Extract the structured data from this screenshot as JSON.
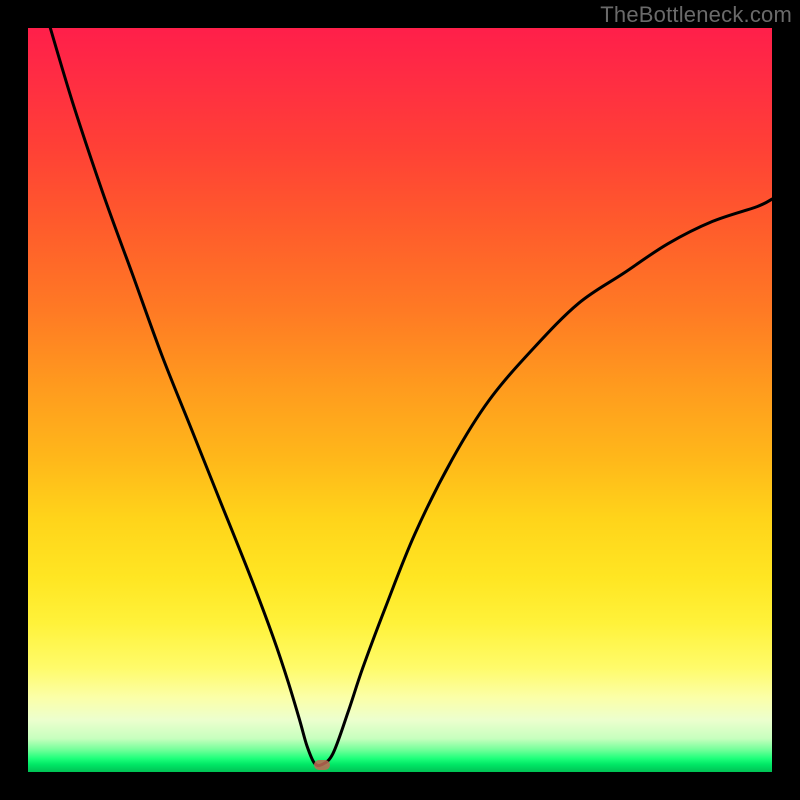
{
  "watermark": "TheBottleneck.com",
  "chart_data": {
    "type": "line",
    "title": "",
    "xlabel": "",
    "ylabel": "",
    "xlim": [
      0,
      100
    ],
    "ylim": [
      0,
      100
    ],
    "series": [
      {
        "name": "curve",
        "x": [
          3,
          6,
          10,
          14,
          18,
          22,
          26,
          30,
          33,
          35,
          36.5,
          37.5,
          38.5,
          39.5,
          41,
          43,
          45,
          48,
          52,
          57,
          62,
          68,
          74,
          80,
          86,
          92,
          98,
          100
        ],
        "values": [
          100,
          90,
          78,
          67,
          56,
          46,
          36,
          26,
          18,
          12,
          7,
          3.5,
          1.2,
          1.0,
          2.5,
          8,
          14,
          22,
          32,
          42,
          50,
          57,
          63,
          67,
          71,
          74,
          76,
          77
        ]
      }
    ],
    "notch": {
      "x": 39.5,
      "y": 1
    },
    "gradient_colors": {
      "top": "#ff1f4a",
      "mid": "#ffe623",
      "bottom": "#00c255"
    }
  }
}
